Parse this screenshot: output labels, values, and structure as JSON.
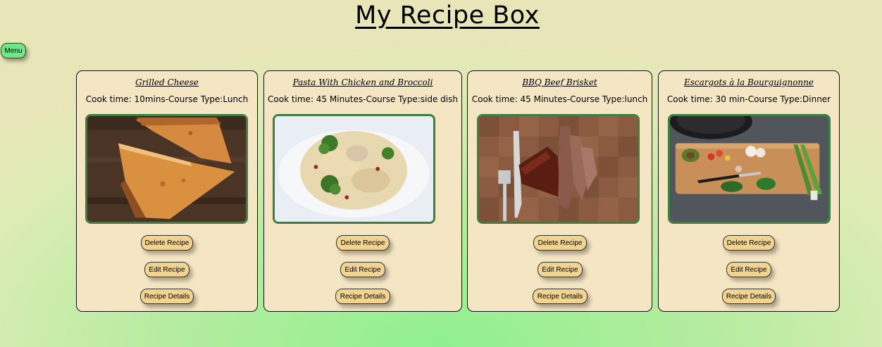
{
  "header": {
    "title": "My Recipe Box"
  },
  "nav": {
    "menu_label": "Menu"
  },
  "buttons": {
    "delete": "Delete Recipe",
    "edit": "Edit Recipe",
    "details": "Recipe Details"
  },
  "recipes": [
    {
      "name": "Grilled Cheese",
      "meta": "Cook time: 10mins-Course Type:Lunch"
    },
    {
      "name": "Pasta With Chicken and Broccoli",
      "meta": "Cook time: 45 Minutes-Course Type:side dish"
    },
    {
      "name": "BBQ Beef Brisket",
      "meta": "Cook time: 45 Minutes-Course Type:lunch"
    },
    {
      "name": "Escargots à la Bourguignonne",
      "meta": "Cook time: 30 min-Course Type:Dinner"
    }
  ]
}
